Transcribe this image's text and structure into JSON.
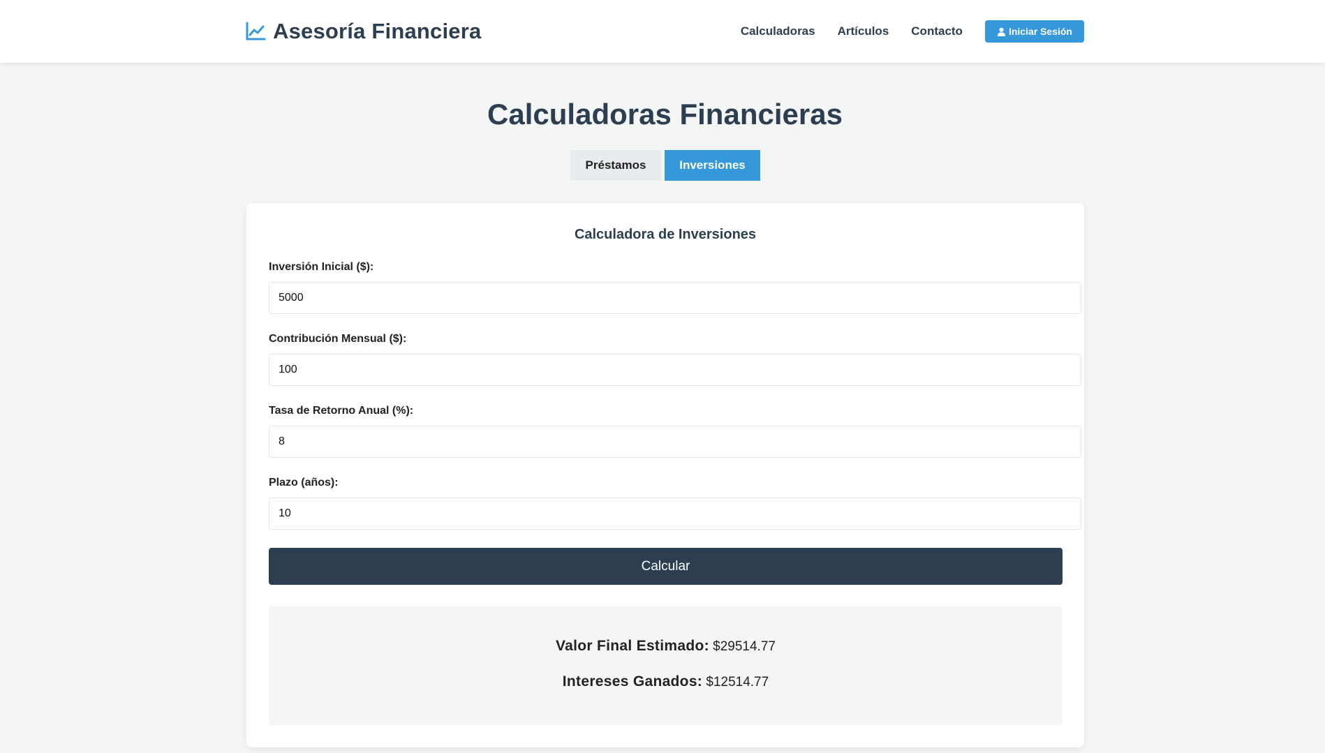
{
  "header": {
    "brand": "Asesoría Financiera",
    "brand_icon": "chart-line-icon",
    "nav": {
      "calculadoras": "Calculadoras",
      "articulos": "Artículos",
      "contacto": "Contacto"
    },
    "login_label": "Iniciar Sesión",
    "login_icon": "user-icon"
  },
  "main": {
    "title": "Calculadoras Financieras",
    "tabs": {
      "prestamos": "Préstamos",
      "inversiones": "Inversiones"
    },
    "active_tab": "Inversiones"
  },
  "calculator": {
    "title": "Calculadora de Inversiones",
    "fields": {
      "initial": {
        "label": "Inversión Inicial ($):",
        "value": "5000"
      },
      "monthly": {
        "label": "Contribución Mensual ($):",
        "value": "100"
      },
      "rate": {
        "label": "Tasa de Retorno Anual (%):",
        "value": "8"
      },
      "term": {
        "label": "Plazo (años):",
        "value": "10"
      }
    },
    "button_label": "Calcular",
    "results": {
      "final_label": "Valor Final Estimado:",
      "final_value": "$29514.77",
      "interest_label": "Intereses Ganados:",
      "interest_value": "$12514.77"
    }
  },
  "colors": {
    "accent": "#3498db",
    "dark": "#2c3e50",
    "background": "#f4f5f5"
  }
}
